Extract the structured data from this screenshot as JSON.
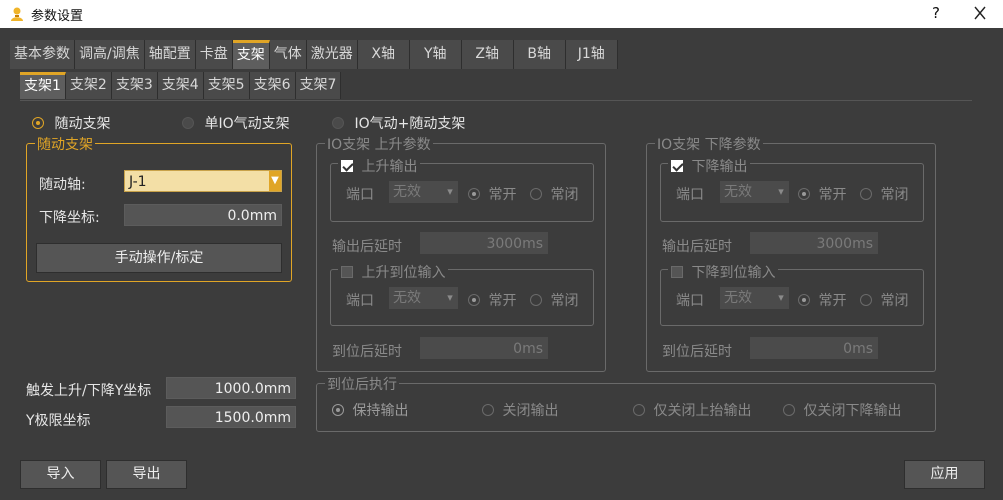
{
  "window": {
    "title": "参数设置",
    "help": "?",
    "close_icon": "close-icon"
  },
  "main_tabs": [
    "基本参数",
    "调高/调焦",
    "轴配置",
    "卡盘",
    "支架",
    "气体",
    "激光器",
    "X轴",
    "Y轴",
    "Z轴",
    "B轴",
    "J1轴"
  ],
  "sub_tabs": [
    "支架1",
    "支架2",
    "支架3",
    "支架4",
    "支架5",
    "支架6",
    "支架7"
  ],
  "mode": {
    "follow": "随动支架",
    "single_io": "单IO气动支架",
    "io_follow": "IO气动+随动支架"
  },
  "follow_group": {
    "title": "随动支架",
    "axis_label": "随动轴:",
    "axis_value": "J-1",
    "lower_label": "下降坐标:",
    "lower_value": "0.0mm",
    "manual_button": "手动操作/标定"
  },
  "trigger": {
    "label": "触发上升/下降Y坐标",
    "value": "1000.0mm"
  },
  "ylimit": {
    "label": "Y极限坐标",
    "value": "1500.0mm"
  },
  "up_group": {
    "title": "IO支架 上升参数",
    "output_check": "上升输出",
    "port_label": "端口",
    "port_value": "无效",
    "no": "常开",
    "nc": "常闭",
    "delay_label": "输出后延时",
    "delay_value": "3000ms",
    "input_check": "上升到位输入",
    "port2_value": "无效",
    "arrive_label": "到位后延时",
    "arrive_value": "0ms"
  },
  "down_group": {
    "title": "IO支架 下降参数",
    "output_check": "下降输出",
    "port_label": "端口",
    "port_value": "无效",
    "no": "常开",
    "nc": "常闭",
    "delay_label": "输出后延时",
    "delay_value": "3000ms",
    "input_check": "下降到位输入",
    "port2_value": "无效",
    "arrive_label": "到位后延时",
    "arrive_value": "0ms"
  },
  "after_group": {
    "title": "到位后执行",
    "opt1": "保持输出",
    "opt2": "关闭输出",
    "opt3": "仅关闭上抬输出",
    "opt4": "仅关闭下降输出"
  },
  "buttons": {
    "import": "导入",
    "export": "导出",
    "apply": "应用"
  },
  "colors": {
    "accent": "#e0a526",
    "background": "#3c3c3c"
  }
}
